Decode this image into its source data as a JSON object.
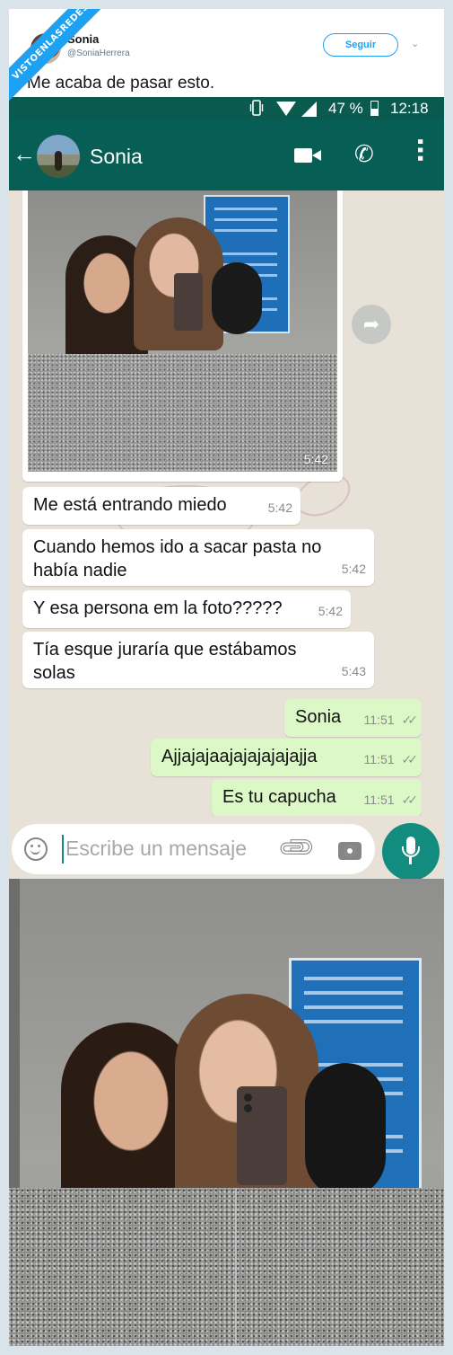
{
  "watermark": {
    "text": "VISTOENLASREDES"
  },
  "tweet": {
    "name": "Sonia",
    "handle": "@SoniaHerrera",
    "follow_label": "Seguir",
    "text": "Me acaba de pasar esto."
  },
  "status_bar": {
    "battery": "47 %",
    "time": "12:18"
  },
  "chat_header": {
    "contact_name": "Sonia"
  },
  "messages": [
    {
      "direction": "in",
      "type": "photo",
      "time": "5:42"
    },
    {
      "direction": "in",
      "text": "Me está entrando miedo",
      "time": "5:42"
    },
    {
      "direction": "in",
      "text": "Cuando hemos ido a sacar pasta no había nadie",
      "time": "5:42"
    },
    {
      "direction": "in",
      "text": "Y esa persona em la foto?????",
      "time": "5:42"
    },
    {
      "direction": "in",
      "text": "Tía esque juraría que estábamos solas",
      "time": "5:43"
    },
    {
      "direction": "out",
      "text": "Sonia",
      "time": "11:51"
    },
    {
      "direction": "out",
      "text": "Ajjajajaajajajajajajja",
      "time": "11:51"
    },
    {
      "direction": "out",
      "text": "Es tu capucha",
      "time": "11:51"
    }
  ],
  "input": {
    "placeholder": "Escribe un mensaje"
  },
  "colors": {
    "whatsapp_header": "#075e54",
    "status_bar": "#0b5a4f",
    "outgoing_bubble": "#dcf8c6",
    "chat_background": "#e8e1d7",
    "twitter_blue": "#1da1f2",
    "mic_button": "#128c7e"
  },
  "icons": {
    "back": "arrow-left-icon",
    "video": "video-camera-icon",
    "call": "phone-icon",
    "more": "more-vertical-icon",
    "forward": "forward-icon",
    "emoji": "emoji-icon",
    "attach": "paperclip-icon",
    "camera": "camera-icon",
    "mic": "microphone-icon",
    "read_receipt": "double-check-icon"
  }
}
